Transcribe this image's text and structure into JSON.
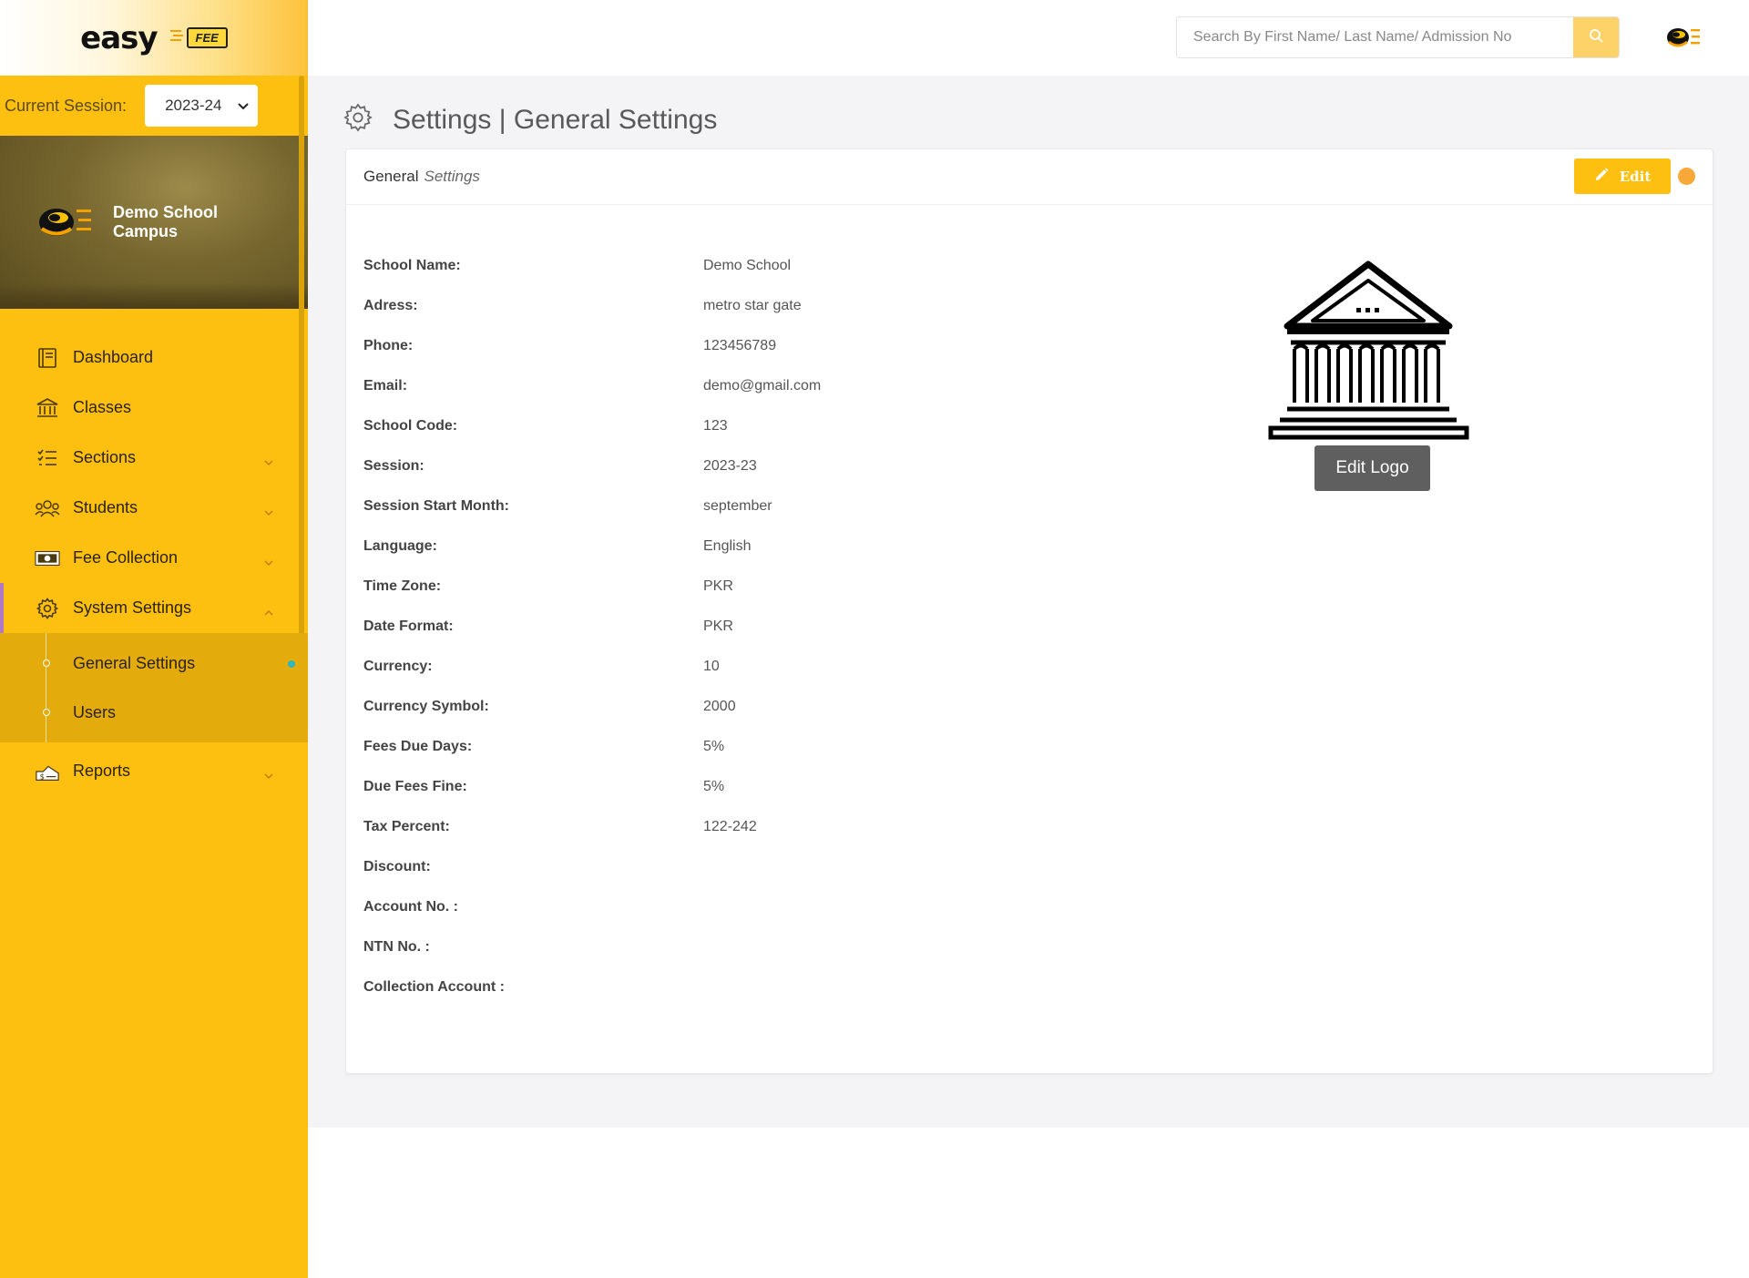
{
  "brand": {
    "name": "easy",
    "tag": "FEE"
  },
  "session": {
    "label": "Current Session:",
    "value": "2023-24"
  },
  "campus": {
    "name": "Demo School Campus"
  },
  "nav": [
    {
      "label": "Dashboard",
      "icon": "dashboard-icon"
    },
    {
      "label": "Classes",
      "icon": "classes-icon"
    },
    {
      "label": "Sections",
      "icon": "sections-icon",
      "expandable": true
    },
    {
      "label": "Students",
      "icon": "students-icon",
      "expandable": true
    },
    {
      "label": "Fee Collection",
      "icon": "fee-collection-icon",
      "expandable": true
    },
    {
      "label": "System Settings",
      "icon": "gear-icon",
      "expanded": true,
      "children": [
        {
          "label": "General Settings",
          "active": true
        },
        {
          "label": "Users"
        }
      ]
    },
    {
      "label": "Reports",
      "icon": "reports-icon",
      "expandable": true
    }
  ],
  "search": {
    "placeholder": "Search By First Name/ Last Name/ Admission No"
  },
  "page": {
    "title": "Settings | General Settings"
  },
  "card": {
    "title_main": "General",
    "title_sub": "Settings",
    "edit_label": "Edit",
    "edit_logo_label": "Edit Logo",
    "fields": [
      {
        "label": "School Name:",
        "value": "Demo School"
      },
      {
        "label": "Adress:",
        "value": "metro star gate"
      },
      {
        "label": "Phone:",
        "value": "123456789"
      },
      {
        "label": "Email:",
        "value": "demo@gmail.com"
      },
      {
        "label": "School Code:",
        "value": "123"
      },
      {
        "label": "Session:",
        "value": "2023-23"
      },
      {
        "label": "Session Start Month:",
        "value": "september"
      },
      {
        "label": "Language:",
        "value": "English"
      },
      {
        "label": "Time Zone:",
        "value": "PKR"
      },
      {
        "label": "Date Format:",
        "value": "PKR"
      },
      {
        "label": "Currency:",
        "value": "10"
      },
      {
        "label": "Currency Symbol:",
        "value": "2000"
      },
      {
        "label": "Fees Due Days:",
        "value": "5%"
      },
      {
        "label": "Due Fees Fine:",
        "value": "5%"
      },
      {
        "label": "Tax Percent:",
        "value": "122-242"
      },
      {
        "label": "Discount:",
        "value": ""
      },
      {
        "label": "Account No. :",
        "value": ""
      },
      {
        "label": "NTN No. :",
        "value": ""
      },
      {
        "label": "Collection Account :",
        "value": ""
      }
    ]
  },
  "colors": {
    "sidebar": "#fdbf10",
    "accent": "#fdbf10",
    "status": "#f7a838",
    "active_dot": "#2eb8b8"
  }
}
